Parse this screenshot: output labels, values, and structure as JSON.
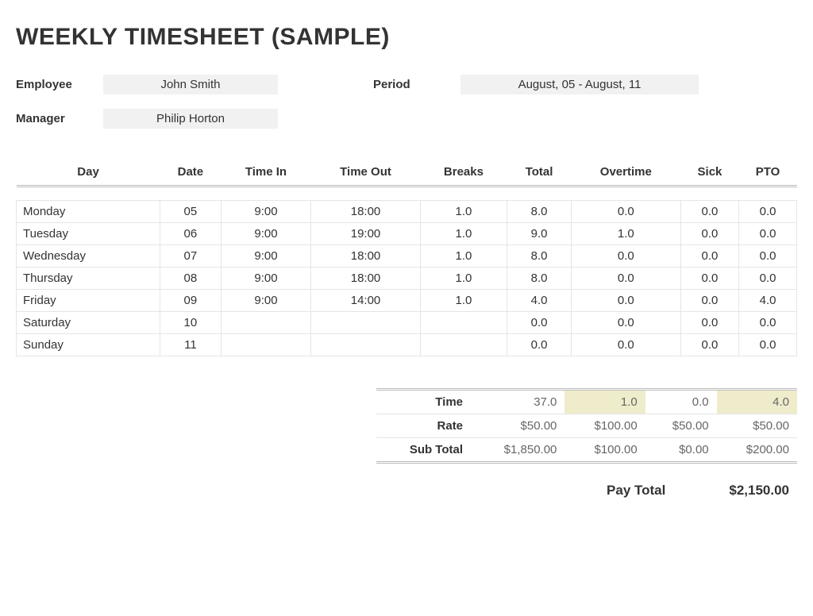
{
  "title": "WEEKLY TIMESHEET (SAMPLE)",
  "meta": {
    "employee_label": "Employee",
    "employee": "John Smith",
    "period_label": "Period",
    "period": "August, 05 - August, 11",
    "manager_label": "Manager",
    "manager": "Philip Horton"
  },
  "cols": [
    "Day",
    "Date",
    "Time In",
    "Time Out",
    "Breaks",
    "Total",
    "Overtime",
    "Sick",
    "PTO"
  ],
  "rows": [
    {
      "day": "Monday",
      "date": "05",
      "in": "9:00",
      "out": "18:00",
      "breaks": "1.0",
      "total": "8.0",
      "ot": "0.0",
      "sick": "0.0",
      "pto": "0.0"
    },
    {
      "day": "Tuesday",
      "date": "06",
      "in": "9:00",
      "out": "19:00",
      "breaks": "1.0",
      "total": "9.0",
      "ot": "1.0",
      "sick": "0.0",
      "pto": "0.0"
    },
    {
      "day": "Wednesday",
      "date": "07",
      "in": "9:00",
      "out": "18:00",
      "breaks": "1.0",
      "total": "8.0",
      "ot": "0.0",
      "sick": "0.0",
      "pto": "0.0"
    },
    {
      "day": "Thursday",
      "date": "08",
      "in": "9:00",
      "out": "18:00",
      "breaks": "1.0",
      "total": "8.0",
      "ot": "0.0",
      "sick": "0.0",
      "pto": "0.0"
    },
    {
      "day": "Friday",
      "date": "09",
      "in": "9:00",
      "out": "14:00",
      "breaks": "1.0",
      "total": "4.0",
      "ot": "0.0",
      "sick": "0.0",
      "pto": "4.0"
    },
    {
      "day": "Saturday",
      "date": "10",
      "in": "",
      "out": "",
      "breaks": "",
      "total": "0.0",
      "ot": "0.0",
      "sick": "0.0",
      "pto": "0.0"
    },
    {
      "day": "Sunday",
      "date": "11",
      "in": "",
      "out": "",
      "breaks": "",
      "total": "0.0",
      "ot": "0.0",
      "sick": "0.0",
      "pto": "0.0"
    }
  ],
  "totals": {
    "time_label": "Time",
    "time": [
      "37.0",
      "1.0",
      "0.0",
      "4.0"
    ],
    "rate_label": "Rate",
    "rate": [
      "$50.00",
      "$100.00",
      "$50.00",
      "$50.00"
    ],
    "sub_label": "Sub Total",
    "sub": [
      "$1,850.00",
      "$100.00",
      "$0.00",
      "$200.00"
    ]
  },
  "paytotal_label": "Pay Total",
  "paytotal": "$2,150.00"
}
